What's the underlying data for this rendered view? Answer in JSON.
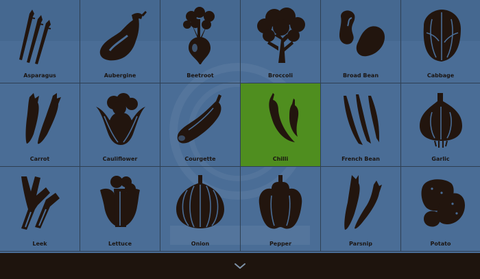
{
  "grid": {
    "tiles": [
      {
        "label": "Asparagus",
        "icon": "asparagus-icon",
        "selected": false
      },
      {
        "label": "Aubergine",
        "icon": "aubergine-icon",
        "selected": false
      },
      {
        "label": "Beetroot",
        "icon": "beetroot-icon",
        "selected": false
      },
      {
        "label": "Broccoli",
        "icon": "broccoli-icon",
        "selected": false
      },
      {
        "label": "Broad Bean",
        "icon": "broad-bean-icon",
        "selected": false
      },
      {
        "label": "Cabbage",
        "icon": "cabbage-icon",
        "selected": false
      },
      {
        "label": "Carrot",
        "icon": "carrot-icon",
        "selected": false
      },
      {
        "label": "Cauliflower",
        "icon": "cauliflower-icon",
        "selected": false
      },
      {
        "label": "Courgette",
        "icon": "courgette-icon",
        "selected": false
      },
      {
        "label": "Chilli",
        "icon": "chilli-icon",
        "selected": true
      },
      {
        "label": "French Bean",
        "icon": "french-bean-icon",
        "selected": false
      },
      {
        "label": "Garlic",
        "icon": "garlic-icon",
        "selected": false
      },
      {
        "label": "Leek",
        "icon": "leek-icon",
        "selected": false
      },
      {
        "label": "Lettuce",
        "icon": "lettuce-icon",
        "selected": false
      },
      {
        "label": "Onion",
        "icon": "onion-icon",
        "selected": false
      },
      {
        "label": "Pepper",
        "icon": "pepper-icon",
        "selected": false
      },
      {
        "label": "Parsnip",
        "icon": "parsnip-icon",
        "selected": false
      },
      {
        "label": "Potato",
        "icon": "potato-icon",
        "selected": false
      }
    ]
  },
  "bottom_bar": {
    "icon": "chevron-down-icon"
  },
  "colors": {
    "background": "#4a6d96",
    "selected": "#4f8e1f",
    "silhouette": "#22150e",
    "bottom_bar": "#1e140d"
  }
}
